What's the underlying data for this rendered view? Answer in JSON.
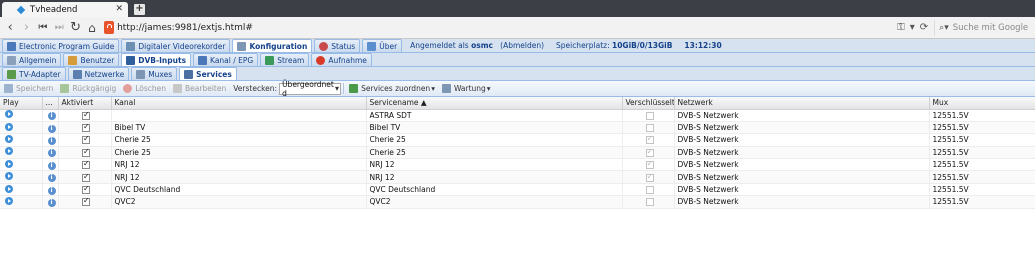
{
  "browser": {
    "tab_title": "Tvheadend",
    "url": "http://james:9981/extjs.html#",
    "search_placeholder": "Suche mit Google"
  },
  "main_tabs": [
    {
      "label": "Electronic Program Guide",
      "icon": "epg-icon"
    },
    {
      "label": "Digitaler Videorekorder",
      "icon": "dvr-icon"
    },
    {
      "label": "Konfiguration",
      "icon": "wrench-icon",
      "active": true
    },
    {
      "label": "Status",
      "icon": "status-icon"
    },
    {
      "label": "Über",
      "icon": "info-icon"
    }
  ],
  "status_bar": {
    "logged_in_prefix": "Angemeldet als",
    "user": "osmc",
    "logout": "(Abmelden)",
    "storage_prefix": "Speicherplatz:",
    "storage": "10GiB/0/13GiB",
    "time": "13:12:30"
  },
  "config_tabs": [
    {
      "label": "Allgemein",
      "icon": "general-icon"
    },
    {
      "label": "Benutzer",
      "icon": "users-icon"
    },
    {
      "label": "DVB-Inputs",
      "icon": "dvb-icon",
      "active": true
    },
    {
      "label": "Kanal / EPG",
      "icon": "channel-icon"
    },
    {
      "label": "Stream",
      "icon": "stream-icon"
    },
    {
      "label": "Aufnahme",
      "icon": "record-icon"
    }
  ],
  "dvb_tabs": [
    {
      "label": "TV-Adapter",
      "icon": "adapter-icon"
    },
    {
      "label": "Netzwerke",
      "icon": "network-icon"
    },
    {
      "label": "Muxes",
      "icon": "mux-icon"
    },
    {
      "label": "Services",
      "icon": "services-icon",
      "active": true
    }
  ],
  "toolbar": {
    "save": "Speichern",
    "undo": "Rückgängig",
    "delete": "Löschen",
    "edit": "Bearbeiten",
    "hide_label": "Verstecken:",
    "hide_value": "Übergeordnet d",
    "map_services": "Services zuordnen",
    "maintenance": "Wartung"
  },
  "columns": [
    "Play",
    "...",
    "Aktiviert",
    "Kanal",
    "Servicename ▲",
    "Verschlüsselt",
    "Netzwerk",
    "Mux"
  ],
  "rows": [
    {
      "kanal": "",
      "servicename": "ASTRA SDT",
      "enabled": true,
      "encrypted": false,
      "netzwerk": "DVB-S Netzwerk",
      "mux": "12551.5V"
    },
    {
      "kanal": "Bibel TV",
      "servicename": "Bibel TV",
      "enabled": true,
      "encrypted": false,
      "netzwerk": "DVB-S Netzwerk",
      "mux": "12551.5V"
    },
    {
      "kanal": "Cherie 25",
      "servicename": "Cherie 25",
      "enabled": true,
      "encrypted": true,
      "netzwerk": "DVB-S Netzwerk",
      "mux": "12551.5V"
    },
    {
      "kanal": "Cherie 25",
      "servicename": "Cherie 25",
      "enabled": true,
      "encrypted": true,
      "netzwerk": "DVB-S Netzwerk",
      "mux": "12551.5V"
    },
    {
      "kanal": "NRJ 12",
      "servicename": "NRJ 12",
      "enabled": true,
      "encrypted": true,
      "netzwerk": "DVB-S Netzwerk",
      "mux": "12551.5V"
    },
    {
      "kanal": "NRJ 12",
      "servicename": "NRJ 12",
      "enabled": true,
      "encrypted": true,
      "netzwerk": "DVB-S Netzwerk",
      "mux": "12551.5V"
    },
    {
      "kanal": "QVC Deutschland",
      "servicename": "QVC Deutschland",
      "enabled": true,
      "encrypted": false,
      "netzwerk": "DVB-S Netzwerk",
      "mux": "12551.5V"
    },
    {
      "kanal": "QVC2",
      "servicename": "QVC2",
      "enabled": true,
      "encrypted": false,
      "netzwerk": "DVB-S Netzwerk",
      "mux": "12551.5V"
    }
  ],
  "colors": {
    "ext_blue": "#15428b",
    "tab_bg": "#d6e2ef",
    "browser_dark": "#3c3f46"
  }
}
